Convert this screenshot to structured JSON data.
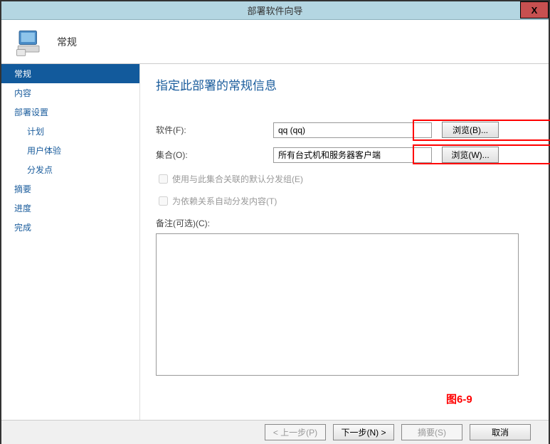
{
  "titlebar": {
    "title": "部署软件向导",
    "close": "X"
  },
  "header": {
    "label": "常规"
  },
  "sidebar": {
    "items": [
      {
        "label": "常规",
        "active": true,
        "indent": false
      },
      {
        "label": "内容",
        "active": false,
        "indent": false
      },
      {
        "label": "部署设置",
        "active": false,
        "indent": false
      },
      {
        "label": "计划",
        "active": false,
        "indent": true
      },
      {
        "label": "用户体验",
        "active": false,
        "indent": true
      },
      {
        "label": "分发点",
        "active": false,
        "indent": true
      },
      {
        "label": "摘要",
        "active": false,
        "indent": false
      },
      {
        "label": "进度",
        "active": false,
        "indent": false
      },
      {
        "label": "完成",
        "active": false,
        "indent": false
      }
    ]
  },
  "main": {
    "heading": "指定此部署的常规信息",
    "software": {
      "label": "软件(F):",
      "value": "qq (qq)",
      "browse": "浏览(B)..."
    },
    "collection": {
      "label": "集合(O):",
      "value": "所有台式机和服务器客户端",
      "browse": "浏览(W)..."
    },
    "checkbox1": "使用与此集合关联的默认分发组(E)",
    "checkbox2": "为依赖关系自动分发内容(T)",
    "remark": {
      "label": "备注(可选)(C):",
      "value": ""
    },
    "figure_caption": "图6-9"
  },
  "footer": {
    "prev": "< 上一步(P)",
    "next": "下一步(N) >",
    "summary": "摘要(S)",
    "cancel": "取消"
  }
}
